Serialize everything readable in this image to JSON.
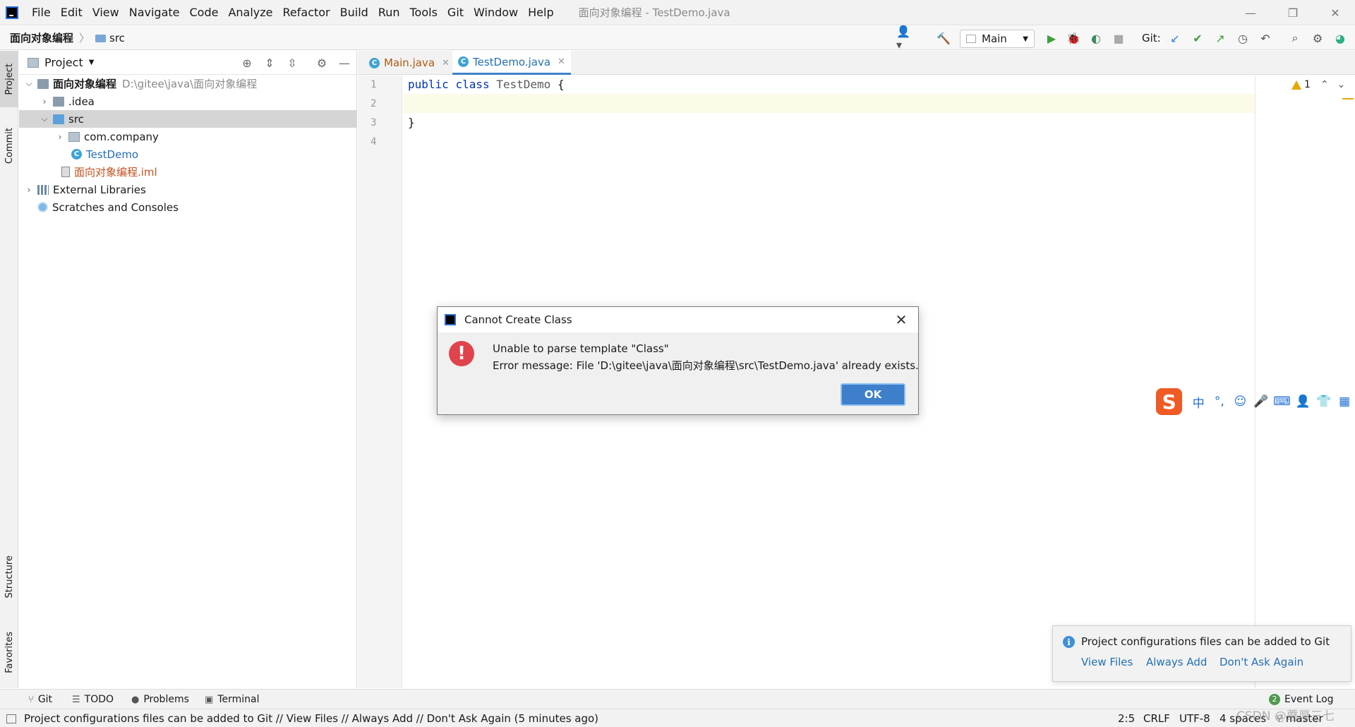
{
  "window": {
    "title": "面向对象编程 - TestDemo.java",
    "controls": {
      "minimize": "—",
      "maximize": "❐",
      "close": "✕"
    }
  },
  "menu": [
    "File",
    "Edit",
    "View",
    "Navigate",
    "Code",
    "Analyze",
    "Refactor",
    "Build",
    "Run",
    "Tools",
    "Git",
    "Window",
    "Help"
  ],
  "breadcrumb": {
    "project": "面向对象编程",
    "folder": "src"
  },
  "toolbar": {
    "run_config": "Main",
    "git_label": "Git:"
  },
  "left_stripe": {
    "project": "Project",
    "commit": "Commit",
    "structure": "Structure",
    "favorites": "Favorites"
  },
  "project_panel": {
    "title": "Project",
    "tree": {
      "root_name": "面向对象编程",
      "root_path": "D:\\gitee\\java\\面向对象编程",
      "idea": ".idea",
      "src": "src",
      "package": "com.company",
      "class_file": "TestDemo",
      "iml": "面向对象编程.iml",
      "external_libraries": "External Libraries",
      "scratches": "Scratches and Consoles"
    }
  },
  "editor": {
    "tabs": [
      "Main.java",
      "TestDemo.java"
    ],
    "active_tab": 1,
    "line_numbers": [
      "1",
      "2",
      "3",
      "4"
    ],
    "code": {
      "kw1": "public",
      "kw2": "class",
      "name": "TestDemo",
      "open": "{",
      "close": "}"
    },
    "inspection_count": "1"
  },
  "dialog": {
    "title": "Cannot Create Class",
    "line1": "Unable to parse template \"Class\"",
    "line2": "Error message: File 'D:\\gitee\\java\\面向对象编程\\src\\TestDemo.java' already exists.",
    "ok": "OK"
  },
  "ime": {
    "logo": "S",
    "lang": "中",
    "punct": "°,"
  },
  "notification": {
    "text": "Project configurations files can be added to Git",
    "actions": [
      "View Files",
      "Always Add",
      "Don't Ask Again"
    ]
  },
  "tool_windows": [
    "Git",
    "TODO",
    "Problems",
    "Terminal"
  ],
  "event_log": {
    "count": "2",
    "label": "Event Log"
  },
  "status_bar": {
    "message": "Project configurations files can be added to Git // View Files // Always Add // Don't Ask Again (5 minutes ago)",
    "position": "2:5",
    "line_sep": "CRLF",
    "encoding": "UTF-8",
    "indent": "4 spaces",
    "branch": "master"
  },
  "watermark": "CSDN @蘑厚三七"
}
